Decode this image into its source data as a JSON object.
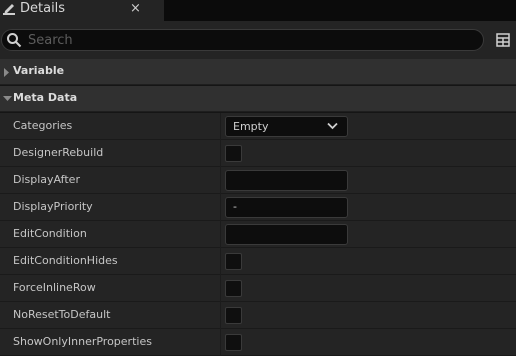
{
  "tab": {
    "title": "Details",
    "close": "×"
  },
  "search": {
    "placeholder": "Search",
    "value": ""
  },
  "sections": {
    "variable": {
      "title": "Variable"
    },
    "meta_data": {
      "title": "Meta Data"
    }
  },
  "properties": [
    {
      "label": "Categories",
      "control": "dropdown",
      "value": "Empty"
    },
    {
      "label": "DesignerRebuild",
      "control": "checkbox",
      "checked": false
    },
    {
      "label": "DisplayAfter",
      "control": "text",
      "value": ""
    },
    {
      "label": "DisplayPriority",
      "control": "text",
      "value": "-"
    },
    {
      "label": "EditCondition",
      "control": "text",
      "value": ""
    },
    {
      "label": "EditConditionHides",
      "control": "checkbox",
      "checked": false
    },
    {
      "label": "ForceInlineRow",
      "control": "checkbox",
      "checked": false
    },
    {
      "label": "NoResetToDefault",
      "control": "checkbox",
      "checked": false
    },
    {
      "label": "ShowOnlyInnerProperties",
      "control": "checkbox",
      "checked": false
    }
  ]
}
